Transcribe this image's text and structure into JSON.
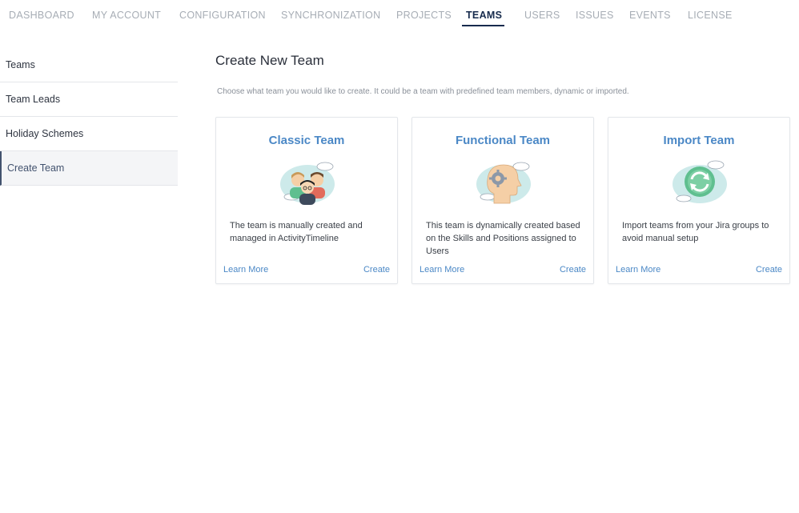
{
  "nav": {
    "items": [
      {
        "label": "DASHBOARD"
      },
      {
        "label": "MY ACCOUNT"
      },
      {
        "label": "CONFIGURATION"
      },
      {
        "label": "SYNCHRONIZATION"
      },
      {
        "label": "PROJECTS"
      },
      {
        "label": "TEAMS"
      },
      {
        "label": "USERS"
      },
      {
        "label": "ISSUES"
      },
      {
        "label": "EVENTS"
      },
      {
        "label": "LICENSE"
      }
    ],
    "active": "TEAMS"
  },
  "sidebar": {
    "items": [
      {
        "label": "Teams"
      },
      {
        "label": "Team Leads"
      },
      {
        "label": "Holiday Schemes"
      },
      {
        "label": "Create Team"
      }
    ],
    "active": "Create Team"
  },
  "main": {
    "title": "Create New Team",
    "subtitle": "Choose what team you would like to create. It could be a team with predefined team members, dynamic or imported.",
    "cards": [
      {
        "title": "Classic Team",
        "icon": "people-icon",
        "description": "The team is manually created and managed in ActivityTimeline",
        "learn_more": "Learn More",
        "create": "Create"
      },
      {
        "title": "Functional Team",
        "icon": "head-gear-icon",
        "description": "This team is dynamically created based on the Skills and Positions assigned to Users",
        "learn_more": "Learn More",
        "create": "Create"
      },
      {
        "title": "Import Team",
        "icon": "sync-icon",
        "description": "Import teams from your Jira groups to avoid manual setup",
        "learn_more": "Learn More",
        "create": "Create"
      }
    ]
  },
  "colors": {
    "accent": "#4b88c6",
    "nav_active": "#172b4d",
    "nav_inactive": "#a7adb5",
    "illustration_cloud": "#cdeaea",
    "illustration_green": "#5fbf8f"
  }
}
